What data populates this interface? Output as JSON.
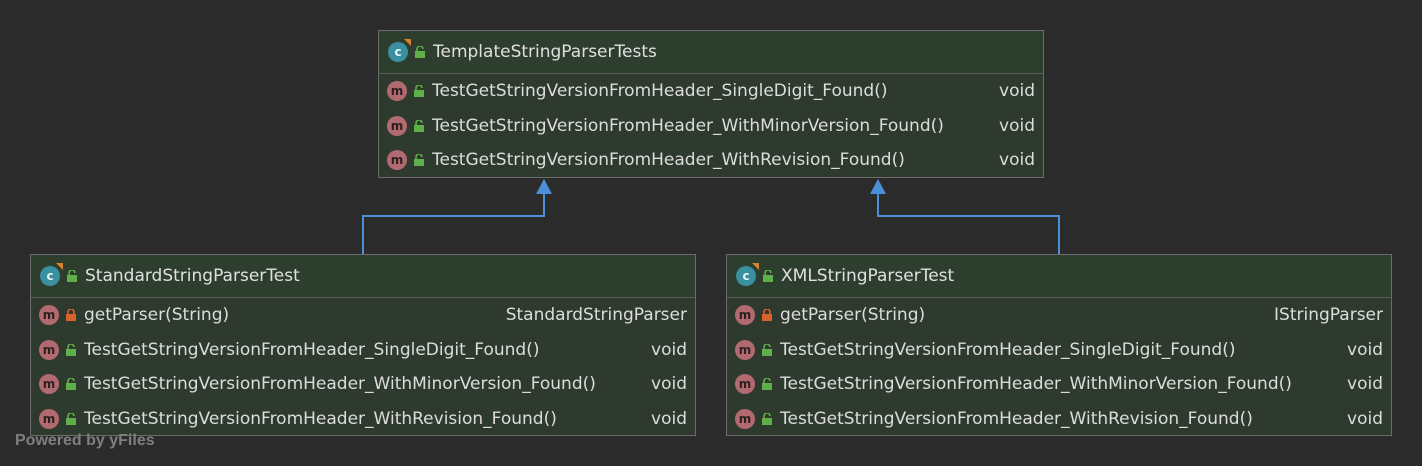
{
  "parent": {
    "name": "TemplateStringParserTests",
    "methods": [
      {
        "name": "TestGetStringVersionFromHeader_SingleDigit_Found()",
        "ret": "void"
      },
      {
        "name": "TestGetStringVersionFromHeader_WithMinorVersion_Found()",
        "ret": "void"
      },
      {
        "name": "TestGetStringVersionFromHeader_WithRevision_Found()",
        "ret": "void"
      }
    ]
  },
  "left_child": {
    "name": "StandardStringParserTest",
    "methods": [
      {
        "name": "getParser(String)",
        "ret": "StandardStringParser"
      },
      {
        "name": "TestGetStringVersionFromHeader_SingleDigit_Found()",
        "ret": "void"
      },
      {
        "name": "TestGetStringVersionFromHeader_WithMinorVersion_Found()",
        "ret": "void"
      },
      {
        "name": "TestGetStringVersionFromHeader_WithRevision_Found()",
        "ret": "void"
      }
    ]
  },
  "right_child": {
    "name": "XMLStringParserTest",
    "methods": [
      {
        "name": "getParser(String)",
        "ret": "IStringParser"
      },
      {
        "name": "TestGetStringVersionFromHeader_SingleDigit_Found()",
        "ret": "void"
      },
      {
        "name": "TestGetStringVersionFromHeader_WithMinorVersion_Found()",
        "ret": "void"
      },
      {
        "name": "TestGetStringVersionFromHeader_WithRevision_Found()",
        "ret": "void"
      }
    ]
  },
  "icons": {
    "class_letter": "c",
    "method_letter": "m"
  },
  "watermark": "Powered by yFiles",
  "colors": {
    "edge": "#4a90d9",
    "lock_public": "#5fb04a",
    "lock_private": "#d9622b"
  }
}
